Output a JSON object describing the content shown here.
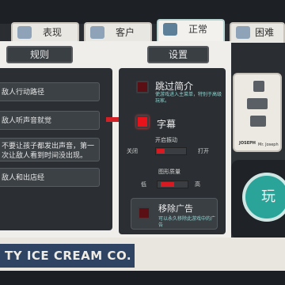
{
  "tabs": [
    {
      "label": "表现",
      "icon": "ice-cream-icon",
      "active": false
    },
    {
      "label": "客户",
      "icon": "cone-icon",
      "active": false
    },
    {
      "label": "正常",
      "icon": "recipe-icon",
      "active": true
    },
    {
      "label": "困难",
      "icon": "trophy-icon",
      "active": false
    }
  ],
  "headers": {
    "rules": "规则",
    "settings": "设置"
  },
  "rules": [
    "敌人行动路径",
    "敌人听声音就觉",
    "不要让孩子都发出声音，第一次让敌人看到时间没出现。",
    "敌人和出店经"
  ],
  "settings": {
    "skip_intro": {
      "title": "跳过简介",
      "desc": "使游戏进入主菜单，特别于高级玩家。",
      "checked": false
    },
    "subtitles": {
      "title": "字幕",
      "checked": true
    },
    "vibration": {
      "title": "开启振动",
      "off_label": "关闭",
      "on_label": "打开",
      "level": 0.25
    },
    "graphics": {
      "title": "图形质量",
      "low_label": "低",
      "high_label": "高",
      "level": 0.45
    },
    "remove_ads": {
      "title": "移除广告",
      "desc": "可以永久移除此游戏中的广告",
      "checked": false
    }
  },
  "card": {
    "name": "JOSEPH",
    "sub": "Mr. Joseph"
  },
  "play_label": "玩",
  "brand": "TY ICE CREAM CO.",
  "colors": {
    "accent_red": "#e8121b",
    "teal": "#2aa399",
    "brand_blue": "#2f4463"
  }
}
